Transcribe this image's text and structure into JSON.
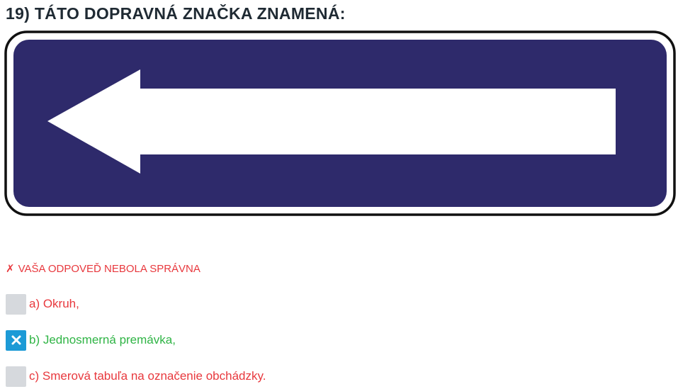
{
  "question": {
    "title": "19) TÁTO DOPRAVNÁ ZNAČKA ZNAMENÁ:"
  },
  "sign": {
    "icon": "one-way-left-arrow-sign",
    "background_color": "#2e2a6b",
    "arrow_color": "#ffffff"
  },
  "feedback": {
    "mark": "✗",
    "text": "VAŠA ODPOVEĎ NEBOLA SPRÁVNA",
    "color": "#e8383d"
  },
  "answers": [
    {
      "label": "a) Okruh,",
      "checked": false,
      "status": "wrong"
    },
    {
      "label": "b) Jednosmerná premávka,",
      "checked": true,
      "status": "correct"
    },
    {
      "label": "c) Smerová tabuľa na označenie obchádzky.",
      "checked": false,
      "status": "wrong"
    }
  ],
  "colors": {
    "correct": "#2fb445",
    "wrong": "#e8383d",
    "checkbox_checked": "#1c9ad6",
    "checkbox_empty": "#d6d9dd"
  }
}
